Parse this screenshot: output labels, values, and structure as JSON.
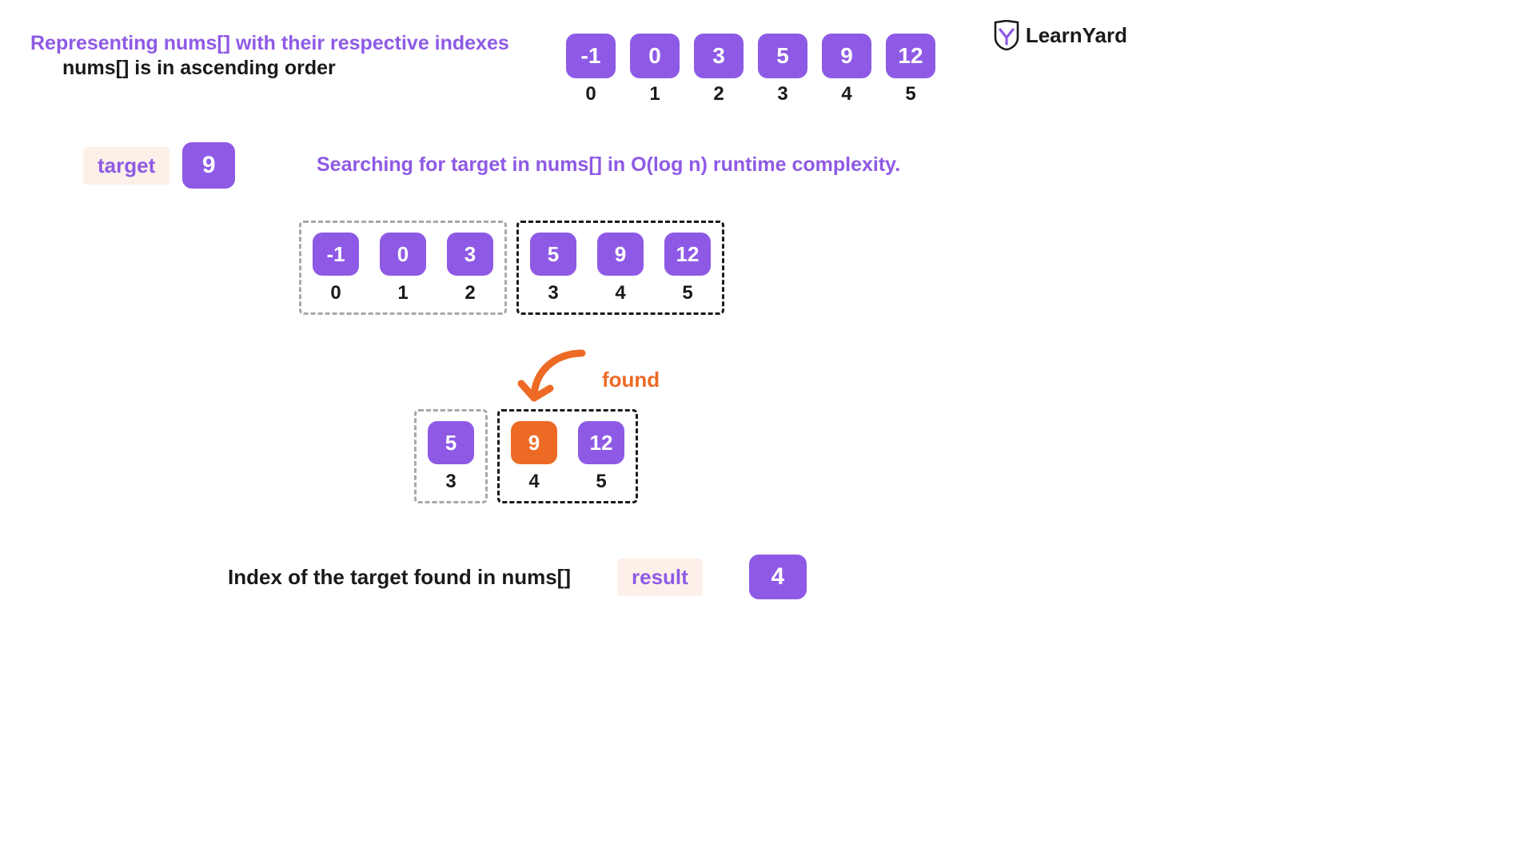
{
  "branding": {
    "name": "LearnYard"
  },
  "heading": {
    "line1": "Representing nums[] with their respective indexes",
    "line2": "nums[] is in ascending order"
  },
  "nums": {
    "values": [
      "-1",
      "0",
      "3",
      "5",
      "9",
      "12"
    ],
    "indexes": [
      "0",
      "1",
      "2",
      "3",
      "4",
      "5"
    ]
  },
  "target": {
    "label": "target",
    "value": "9"
  },
  "search_text": "Searching for target in nums[] in O(log n) runtime complexity.",
  "step1": {
    "left": {
      "values": [
        "-1",
        "0",
        "3"
      ],
      "indexes": [
        "0",
        "1",
        "2"
      ]
    },
    "right": {
      "values": [
        "5",
        "9",
        "12"
      ],
      "indexes": [
        "3",
        "4",
        "5"
      ]
    }
  },
  "found_label": "found",
  "step2": {
    "left": {
      "values": [
        "5"
      ],
      "indexes": [
        "3"
      ]
    },
    "right": {
      "values": [
        "9",
        "12"
      ],
      "indexes": [
        "4",
        "5"
      ],
      "highlight_index": 0
    }
  },
  "result": {
    "text": "Index of the target found in nums[]",
    "label": "result",
    "value": "4"
  }
}
